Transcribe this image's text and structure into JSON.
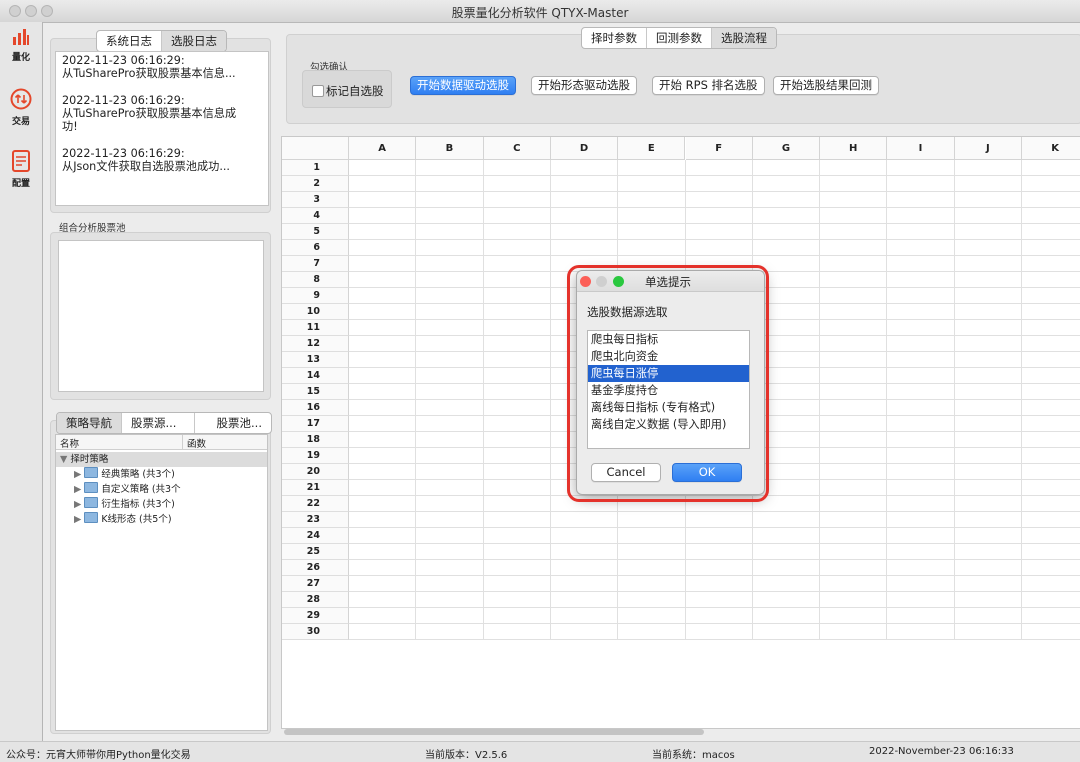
{
  "window": {
    "title": "股票量化分析软件 QTYX-Master"
  },
  "nav": [
    {
      "label": "量化",
      "icon": "bar-chart-icon"
    },
    {
      "label": "交易",
      "icon": "trade-arrows-icon"
    },
    {
      "label": "配置",
      "icon": "config-doc-icon"
    }
  ],
  "log_tabs": [
    "系统日志",
    "选股日志"
  ],
  "log_entries": [
    {
      "time": "2022-11-23 06:16:29:",
      "msg": "从TuSharePro获取股票基本信息..."
    },
    {
      "time": "2022-11-23 06:16:29:",
      "msg": "从TuSharePro获取股票基本信息成功!"
    },
    {
      "time": "2022-11-23 06:16:29:",
      "msg": "从Json文件获取自选股票池成功..."
    }
  ],
  "pool_label": "组合分析股票池",
  "bottom_tabs": [
    "策略导航",
    "股票源...",
    "股票池..."
  ],
  "tree": {
    "headers": [
      "名称",
      "函数"
    ],
    "root": "择时策略",
    "children": [
      "经典策略 (共3个)",
      "自定义策略 (共3个",
      "衍生指标 (共3个)",
      "K线形态 (共5个)"
    ]
  },
  "top_tabs": [
    "择时参数",
    "回测参数",
    "选股流程"
  ],
  "confirm_group": {
    "label": "勾选确认",
    "checkbox": "标记自选股"
  },
  "actions": [
    "开始数据驱动选股",
    "开始形态驱动选股",
    "开始 RPS 排名选股",
    "开始选股结果回测"
  ],
  "columns": [
    "A",
    "B",
    "C",
    "D",
    "E",
    "F",
    "G",
    "H",
    "I",
    "J",
    "K"
  ],
  "rows": 30,
  "dialog": {
    "title": "单选提示",
    "prompt": "选股数据源选取",
    "options": [
      "爬虫每日指标",
      "爬虫北向资金",
      "爬虫每日涨停",
      "基金季度持仓",
      "离线每日指标 (专有格式)",
      "离线自定义数据 (导入即用)"
    ],
    "selected_index": 2,
    "cancel": "Cancel",
    "ok": "OK"
  },
  "status": {
    "left": "公众号：元宵大师带你用Python量化交易",
    "version": "当前版本：V2.5.6",
    "system": "当前系统：macos",
    "datetime": "2022-November-23 06:16:33"
  },
  "colors": {
    "accent": "#2f7ff2",
    "highlight_border": "#e4322b",
    "selection": "#2262cf",
    "nav_icon": "#e4472b"
  }
}
